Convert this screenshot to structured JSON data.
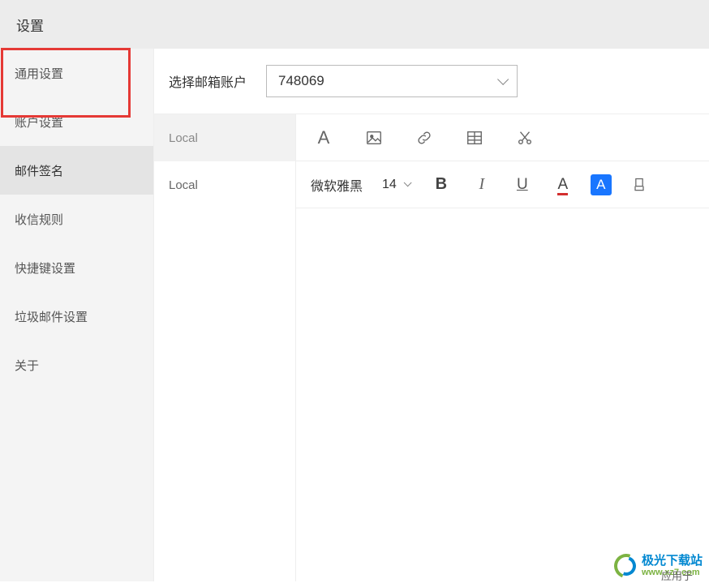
{
  "header": {
    "title": "设置"
  },
  "sidebar": {
    "items": [
      {
        "label": "通用设置"
      },
      {
        "label": "账户设置"
      },
      {
        "label": "邮件签名"
      },
      {
        "label": "收信规则"
      },
      {
        "label": "快捷键设置"
      },
      {
        "label": "垃圾邮件设置"
      },
      {
        "label": "关于"
      }
    ],
    "active_index": 2,
    "highlight_index": 0
  },
  "account_selector": {
    "label": "选择邮箱账户",
    "value": "748069"
  },
  "signatures": {
    "items": [
      {
        "label": "Local"
      },
      {
        "label": "Local"
      }
    ],
    "active_index": 0
  },
  "toolbar1": {
    "text_style": "A",
    "image_icon": "image-icon",
    "link_icon": "link-icon",
    "table_icon": "table-icon",
    "cut_icon": "scissors-icon"
  },
  "toolbar2": {
    "font_name": "微软雅黑",
    "font_size": "14",
    "bold": "B",
    "italic": "I",
    "underline": "U",
    "text_color": "A",
    "bg_color": "A"
  },
  "watermark": {
    "cn": "极光下载站",
    "url": "www.xz7.com"
  },
  "footer_text": "应用于"
}
